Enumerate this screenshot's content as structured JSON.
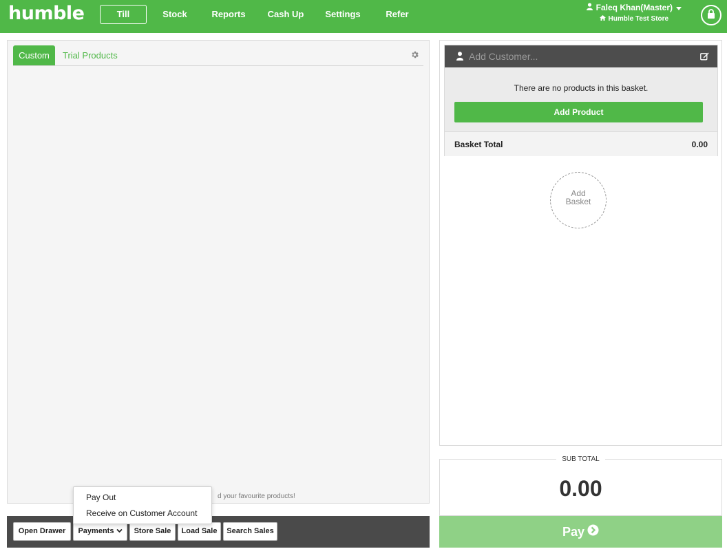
{
  "app": {
    "logo": "humble",
    "nav": [
      {
        "label": "Till",
        "active": true
      },
      {
        "label": "Stock"
      },
      {
        "label": "Reports"
      },
      {
        "label": "Cash Up"
      },
      {
        "label": "Settings"
      },
      {
        "label": "Refer"
      }
    ],
    "user_name": "Faleq Khan(Master)",
    "store_name": "Humble Test Store",
    "brand_color": "#50b848"
  },
  "products": {
    "tabs": [
      {
        "label": "Custom",
        "active": true
      },
      {
        "label": "Trial Products"
      }
    ],
    "empty_hint": "d your favourite products!"
  },
  "toolbar": {
    "buttons": [
      "Open Drawer",
      "Payments",
      "Store Sale",
      "Load Sale",
      "Search Sales"
    ]
  },
  "payments_menu": {
    "items": [
      "Pay Out",
      "Receive on Customer Account"
    ]
  },
  "basket": {
    "customer_placeholder": "Add Customer...",
    "empty_message": "There are no products in this basket.",
    "add_product_label": "Add Product",
    "total_label": "Basket Total",
    "total_value": "0.00",
    "add_basket_line1": "Add",
    "add_basket_line2": "Basket"
  },
  "checkout": {
    "subtotal_label": "SUB TOTAL",
    "subtotal_value": "0.00",
    "pay_label": "Pay"
  }
}
